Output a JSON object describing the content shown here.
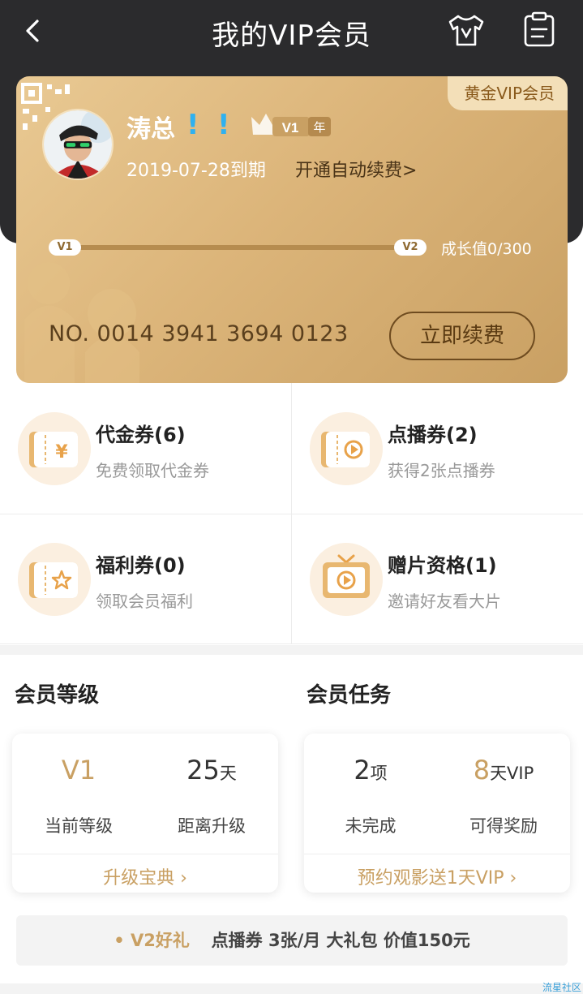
{
  "header": {
    "title": "我的VIP会员",
    "icons": [
      "back-icon",
      "shirt-icon",
      "clipboard-icon"
    ]
  },
  "card": {
    "tier_label": "黄金VIP会员",
    "username": "涛总",
    "exclaims": [
      "!",
      "!"
    ],
    "level_badge": "V1",
    "year_badge": "年",
    "expiry": "2019-07-28到期",
    "auto_renew": "开通自动续费>",
    "progress": {
      "from_level": "V1",
      "to_level": "V2",
      "growth_text": "成长值0/300",
      "value": 0,
      "max": 300
    },
    "card_number": "NO. 0014 3941 3694 0123",
    "renew_button": "立即续费"
  },
  "coupons": [
    {
      "title": "代金券(6)",
      "subtitle": "免费领取代金券",
      "icon": "yen-ticket-icon"
    },
    {
      "title": "点播券(2)",
      "subtitle": "获得2张点播券",
      "icon": "play-ticket-icon"
    },
    {
      "title": "福利券(0)",
      "subtitle": "领取会员福利",
      "icon": "star-ticket-icon"
    },
    {
      "title": "赠片资格(1)",
      "subtitle": "邀请好友看大片",
      "icon": "gift-video-icon"
    }
  ],
  "level_section": {
    "title": "会员等级",
    "current_value": "V1",
    "current_label": "当前等级",
    "days_value": "25",
    "days_unit": "天",
    "days_label": "距离升级",
    "link": "升级宝典 ›"
  },
  "task_section": {
    "title": "会员任务",
    "pending_value": "2",
    "pending_unit": "项",
    "pending_label": "未完成",
    "reward_value": "8",
    "reward_unit": "天VIP",
    "reward_label": "可得奖励",
    "link": "预约观影送1天VIP ›"
  },
  "gift_bar": {
    "lead": "• V2好礼",
    "text": "点播券 3张/月  大礼包 价值150元"
  },
  "watermark": "流星社区",
  "colors": {
    "header_bg": "#2b2b2d",
    "gold": "#c9a063",
    "card_light": "#e9c993",
    "exclaim": "#2fb1f0"
  }
}
